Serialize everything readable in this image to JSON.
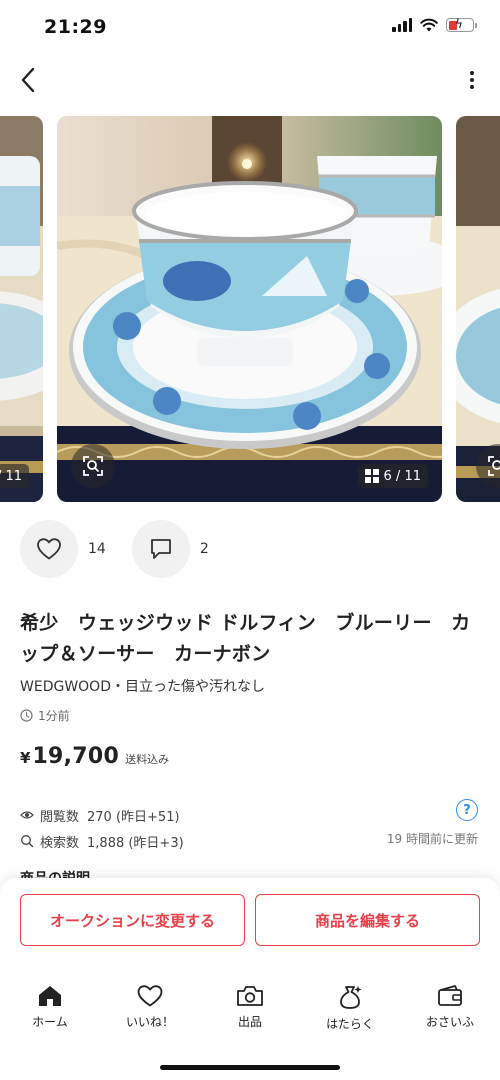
{
  "status": {
    "time": "21:29"
  },
  "gallery": {
    "counter_main": "6 / 11",
    "counter_prev": "/ 11"
  },
  "actions": {
    "likes": "14",
    "comments": "2"
  },
  "item": {
    "title": "希少　ウェッジウッド ドルフィン　ブルーリー　カップ＆ソーサー　カーナボン",
    "brand_condition": "WEDGWOOD・目立った傷や汚れなし",
    "posted": "1分前",
    "price_symbol": "¥",
    "price": "19,700",
    "shipping_note": "送料込み"
  },
  "stats": {
    "views_label": "閲覧数",
    "views_value": "270 (昨日+51)",
    "search_label": "検索数",
    "search_value": "1,888 (昨日+3)",
    "help": "?",
    "updated": "19 時間前に更新"
  },
  "section_peek": "商品の説明",
  "buttons": {
    "auction": "オークションに変更する",
    "edit": "商品を編集する"
  },
  "tabs": [
    {
      "label": "ホーム",
      "icon": "home-icon"
    },
    {
      "label": "いいね！",
      "icon": "heart-icon"
    },
    {
      "label": "出品",
      "icon": "camera-icon"
    },
    {
      "label": "はたらく",
      "icon": "money-bag-icon"
    },
    {
      "label": "おさいふ",
      "icon": "wallet-icon"
    }
  ],
  "colors": {
    "accent": "#e8404a",
    "help": "#2b8ef0",
    "battery_low": "#e53935"
  }
}
